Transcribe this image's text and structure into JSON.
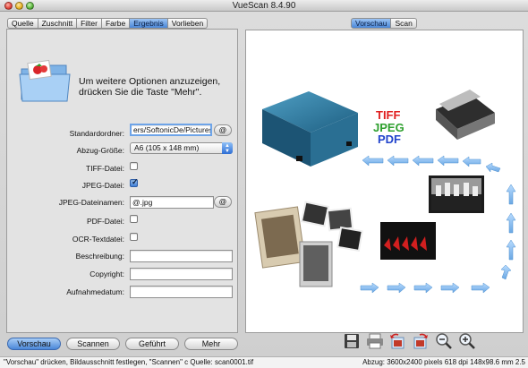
{
  "window": {
    "title": "VueScan 8.4.90"
  },
  "left_tabs": [
    "Quelle",
    "Zuschnitt",
    "Filter",
    "Farbe",
    "Ergebnis",
    "Vorlieben"
  ],
  "right_tabs": [
    "Vorschau",
    "Scan"
  ],
  "info_text": "Um weitere Optionen anzuzeigen, drücken Sie die Taste \"Mehr\".",
  "form": {
    "standardordner": {
      "label": "Standardordner:",
      "value": "ers/SoftonicDe/Pictures",
      "button": "@"
    },
    "abzug_groesse": {
      "label": "Abzug-Größe:",
      "value": "A6 (105 x 148 mm)"
    },
    "tiff": {
      "label": "TIFF-Datei:",
      "checked": false
    },
    "jpeg": {
      "label": "JPEG-Datei:",
      "checked": true
    },
    "jpeg_name": {
      "label": "JPEG-Dateinamen:",
      "value": "@.jpg",
      "button": "@"
    },
    "pdf": {
      "label": "PDF-Datei:",
      "checked": false
    },
    "ocr": {
      "label": "OCR-Textdatei:",
      "checked": false
    },
    "beschreibung": {
      "label": "Beschreibung:",
      "value": ""
    },
    "copyright": {
      "label": "Copyright:",
      "value": ""
    },
    "aufnahmedatum": {
      "label": "Aufnahmedatum:",
      "value": ""
    }
  },
  "preview": {
    "formats": [
      {
        "text": "TIFF",
        "color": "#e02020"
      },
      {
        "text": "JPEG",
        "color": "#2ea02e"
      },
      {
        "text": "PDF",
        "color": "#2244cc"
      }
    ]
  },
  "buttons": {
    "vorschau": "Vorschau",
    "scannen": "Scannen",
    "gefuehrt": "Geführt",
    "mehr": "Mehr"
  },
  "toolbar_icons": [
    "save-icon",
    "print-icon",
    "rotate-left-icon",
    "rotate-right-icon",
    "zoom-out-icon",
    "zoom-in-icon"
  ],
  "status": {
    "left": "\"Vorschau\" drücken, Bildausschnitt festlegen, \"Scannen\" c  Quelle: scan0001.tif",
    "right": "Abzug: 3600x2400 pixels 618 dpi 148x98.6 mm 2.5"
  },
  "colors": {
    "accent": "#4a87d8",
    "arrow": "#7fb6ea"
  }
}
